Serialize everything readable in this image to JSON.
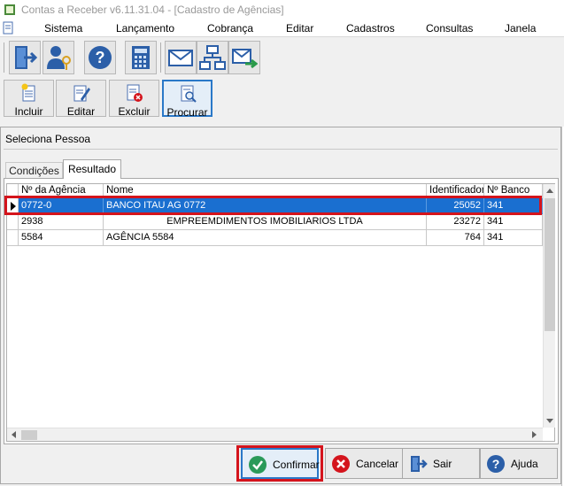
{
  "window": {
    "title": "Contas a Receber v6.11.31.04 - [Cadastro de Agências]"
  },
  "menu": [
    "Sistema",
    "Lançamento",
    "Cobrança",
    "Editar",
    "Cadastros",
    "Consultas",
    "Janela"
  ],
  "toolbar_icons": [
    "exit-door-icon",
    "users-key-icon",
    "help-icon",
    "calculator-icon",
    "envelope-icon",
    "network-icon",
    "email-send-icon"
  ],
  "crud_toolbar": {
    "incluir": "Incluir",
    "editar": "Editar",
    "excluir": "Excluir",
    "procurar": "Procurar"
  },
  "dialog": {
    "title": "Seleciona Pessoa",
    "tabs": [
      "Condições",
      "Resultado"
    ],
    "active_tab": "Resultado"
  },
  "grid": {
    "columns": [
      "Nº da Agência",
      "Nome",
      "Identificador",
      "Nº Banco"
    ],
    "rows": [
      {
        "agencia": "0772-0",
        "nome": "BANCO ITAU AG 0772",
        "identificador": "25052",
        "banco": "341",
        "selected": true
      },
      {
        "agencia": "2938",
        "nome": "EMPREEMDIMENTOS IMOBILIARIOS LTDA",
        "identificador": "23272",
        "banco": "341",
        "selected": false
      },
      {
        "agencia": "5584",
        "nome": "AGÊNCIA 5584",
        "identificador": "764",
        "banco": "341",
        "selected": false
      }
    ]
  },
  "buttons": {
    "confirmar": "Confirmar",
    "cancelar": "Cancelar",
    "sair": "Sair",
    "ajuda": "Ajuda"
  },
  "colors": {
    "selection": "#1a6fd0",
    "highlight": "#d4141c",
    "focus": "#2a78c8"
  }
}
